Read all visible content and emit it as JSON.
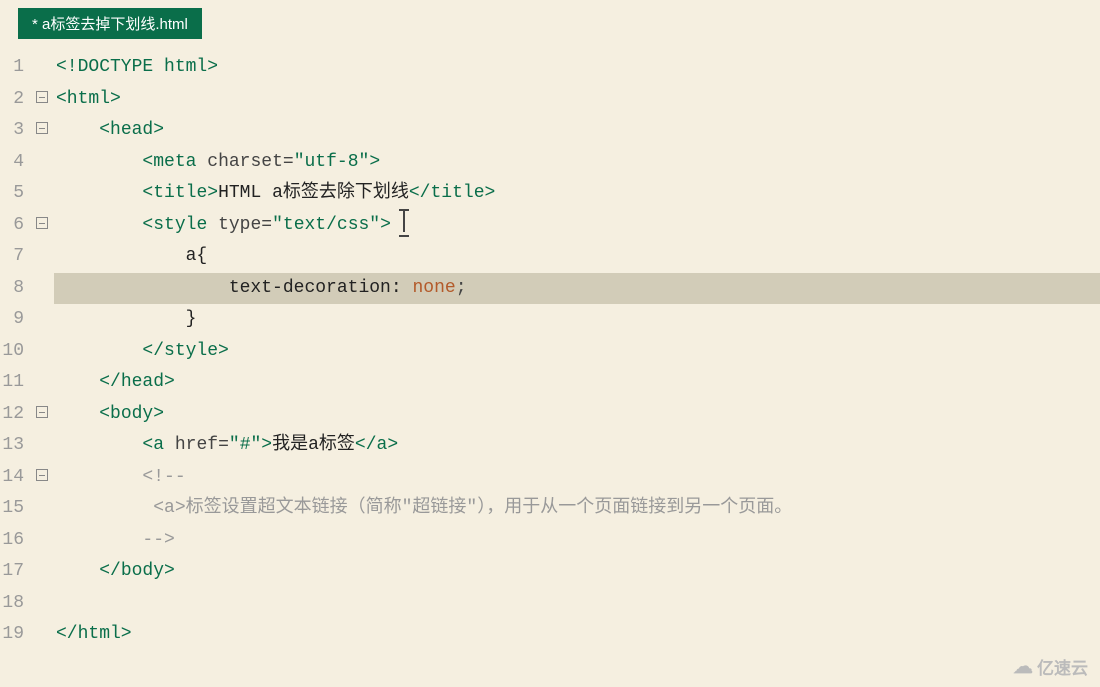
{
  "tab": {
    "label": "* a标签去掉下划线.html"
  },
  "lines": {
    "numbers": [
      "1",
      "2",
      "3",
      "4",
      "5",
      "6",
      "7",
      "8",
      "9",
      "10",
      "11",
      "12",
      "13",
      "14",
      "15",
      "16",
      "17",
      "18",
      "19"
    ],
    "fold": [
      "",
      "−",
      "−",
      "",
      "",
      "−",
      "",
      "",
      "",
      "",
      "",
      "−",
      "",
      "−",
      "",
      "",
      "",
      "",
      ""
    ]
  },
  "code": {
    "l1": "<!DOCTYPE html>",
    "l2": "<html>",
    "l3_open": "<",
    "l3_name": "head",
    "l3_close": ">",
    "l4_open": "<",
    "l4_name": "meta",
    "l4_attr": "charset",
    "l4_eq": "=",
    "l4_val": "\"utf-8\"",
    "l4_close": ">",
    "l5_open": "<",
    "l5_name": "title",
    "l5_close": ">",
    "l5_text": "HTML a标签去除下划线",
    "l5_end_open": "</",
    "l5_end_close": ">",
    "l6_open": "<",
    "l6_name": "style",
    "l6_attr": "type",
    "l6_eq": "=",
    "l6_val": "\"text/css\"",
    "l6_close": ">",
    "l7": "a{",
    "l8_prop": "text-decoration:",
    "l8_sp": " ",
    "l8_val": "none",
    "l8_semi": ";",
    "l9": "}",
    "l10_open": "</",
    "l10_name": "style",
    "l10_close": ">",
    "l11_open": "</",
    "l11_name": "head",
    "l11_close": ">",
    "l12_open": "<",
    "l12_name": "body",
    "l12_close": ">",
    "l13_open": "<",
    "l13_name": "a",
    "l13_attr": "href",
    "l13_eq": "=",
    "l13_val": "\"#\"",
    "l13_close": ">",
    "l13_text": "我是a标签",
    "l13_end_open": "</",
    "l13_end_close": ">",
    "l14": "<!--",
    "l15_a": "<a>",
    "l15_text": "标签设置超文本链接（简称\"超链接\"），用于从一个页面链接到另一个页面。",
    "l16": "-->",
    "l17_open": "</",
    "l17_name": "body",
    "l17_close": ">",
    "l18": "",
    "l19": "</html>"
  },
  "watermark": {
    "text": "亿速云"
  }
}
